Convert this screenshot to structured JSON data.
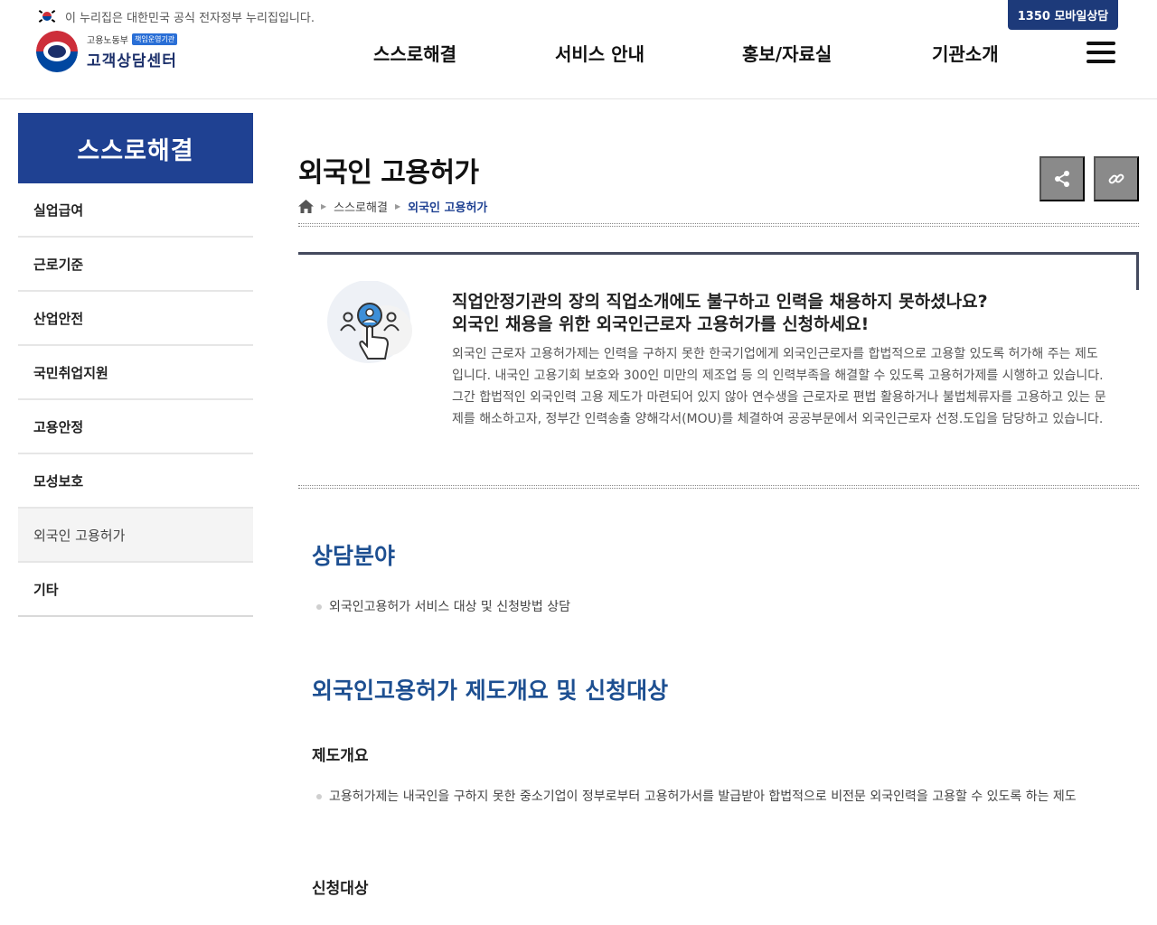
{
  "gov_banner": {
    "text": "이 누리집은 대한민국 공식 전자정부 누리집입니다."
  },
  "mobile_button": {
    "label": "1350 모바일상담"
  },
  "logo": {
    "ministry": "고용노동부",
    "badge": "책임운영기관",
    "name": "고객상담센터"
  },
  "gnb": {
    "items": [
      "스스로해결",
      "서비스 안내",
      "홍보/자료실",
      "기관소개"
    ]
  },
  "sidebar": {
    "title": "스스로해결",
    "items": [
      {
        "label": "실업급여",
        "active": false
      },
      {
        "label": "근로기준",
        "active": false
      },
      {
        "label": "산업안전",
        "active": false
      },
      {
        "label": "국민취업지원",
        "active": false
      },
      {
        "label": "고용안정",
        "active": false
      },
      {
        "label": "모성보호",
        "active": false
      },
      {
        "label": "외국인 고용허가",
        "active": true
      },
      {
        "label": "기타",
        "active": false
      }
    ]
  },
  "page": {
    "title": "외국인 고용허가",
    "breadcrumb": [
      "스스로해결",
      "외국인 고용허가"
    ],
    "share_icon": "share-icon",
    "link_icon": "link-icon"
  },
  "intro": {
    "heading_line1": "직업안정기관의 장의 직업소개에도 불구하고 인력을 채용하지 못하셨나요?",
    "heading_line2": "외국인 채용을 위한 외국인근로자 고용허가를 신청하세요!",
    "body": "외국인 근로자 고용허가제는 인력을 구하지 못한 한국기업에게 외국인근로자를 합법적으로 고용할 있도록 허가해 주는 제도입니다. 내국인 고용기회 보호와 300인 미만의 제조업 등 의 인력부족을 해결할 수 있도록 고용허가제를 시행하고 있습니다. 그간 합법적인 외국인력 고용 제도가 마련되어 있지 않아 연수생을 근로자로 편법 활용하거나 불법체류자를 고용하고 있는 문제를 해소하고자, 정부간 인력송출 양해각서(MOU)를 체결하여 공공부문에서 외국인근로자 선정.도입을 담당하고 있습니다."
  },
  "sections": {
    "consult": {
      "heading": "상담분야",
      "bullet": "외국인고용허가 서비스 대상 및 신청방법 상담"
    },
    "overview": {
      "heading": "외국인고용허가 제도개요 및 신청대상",
      "sub1": "제도개요",
      "bullet1": "고용허가제는 내국인을 구하지 못한 중소기업이 정부로부터 고용허가서를 발급받아 합법적으로 비전문 외국인력을 고용할 수 있도록 하는 제도",
      "sub2": "신청대상"
    }
  },
  "colors": {
    "accent": "#1f4192",
    "heading_blue": "#1d4f91",
    "button_gray": "#8a8a8a"
  }
}
